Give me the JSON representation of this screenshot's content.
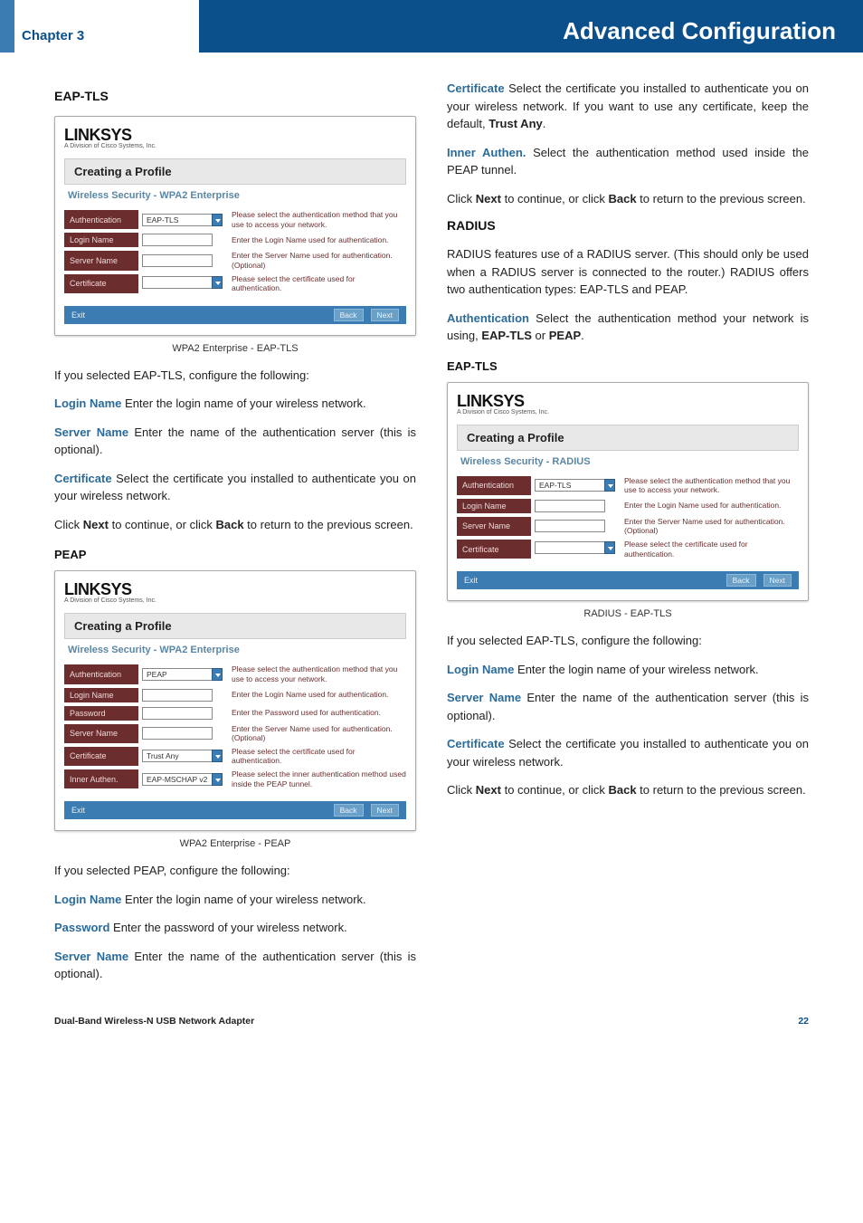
{
  "header": {
    "chapter": "Chapter 3",
    "title": "Advanced Configuration"
  },
  "footer": {
    "product": "Dual-Band Wireless-N USB Network Adapter",
    "page": "22"
  },
  "col1": {
    "h_eaptls": "EAP-TLS",
    "shot_wpa2tls": {
      "logo": "LINKSYS",
      "logo_sub": "A Division of Cisco Systems, Inc.",
      "title": "Creating a Profile",
      "sec": "Wireless Security - WPA2 Enterprise",
      "rows": [
        {
          "label": "Authentication",
          "value": "EAP-TLS",
          "select": true,
          "help": "Please select the authentication method that you use to access your network."
        },
        {
          "label": "Login Name",
          "value": "",
          "select": false,
          "help": "Enter the Login Name used for authentication."
        },
        {
          "label": "Server Name",
          "value": "",
          "select": false,
          "help": "Enter the Server Name used for authentication. (Optional)"
        },
        {
          "label": "Certificate",
          "value": "",
          "select": true,
          "help": "Please select the certificate used for authentication."
        }
      ],
      "footer": {
        "exit": "Exit",
        "back": "Back",
        "next": "Next"
      }
    },
    "cap_wpa2tls": "WPA2 Enterprise - EAP-TLS",
    "p_tls_intro": "If you selected EAP-TLS, configure the following:",
    "t_login": "Login Name",
    "p_login": " Enter the login name of your wireless network.",
    "t_server": "Server Name",
    "p_server": "  Enter the name of the authentication server (this is optional).",
    "t_cert": "Certificate",
    "p_cert": " Select the certificate you installed to authenticate you on your wireless network.",
    "p_nextback1_a": "Click ",
    "p_nextback1_b": " to continue, or click ",
    "p_nextback1_c": " to return to the previous screen.",
    "bold_next": "Next",
    "bold_back": "Back",
    "h_peap": "PEAP",
    "shot_wpa2peap": {
      "logo": "LINKSYS",
      "logo_sub": "A Division of Cisco Systems, Inc.",
      "title": "Creating a Profile",
      "sec": "Wireless Security - WPA2 Enterprise",
      "rows": [
        {
          "label": "Authentication",
          "value": "PEAP",
          "select": true,
          "help": "Please select the authentication method that you use to access your network."
        },
        {
          "label": "Login Name",
          "value": "",
          "select": false,
          "help": "Enter the Login Name used for authentication."
        },
        {
          "label": "Password",
          "value": "",
          "select": false,
          "help": "Enter the Password used for authentication."
        },
        {
          "label": "Server Name",
          "value": "",
          "select": false,
          "help": "Enter the Server Name used for authentication. (Optional)"
        },
        {
          "label": "Certificate",
          "value": "Trust Any",
          "select": true,
          "help": "Please select the certificate used for authentication."
        },
        {
          "label": "Inner Authen.",
          "value": "EAP-MSCHAP v2",
          "select": true,
          "help": "Please select the inner authentication method used inside the PEAP tunnel."
        }
      ],
      "footer": {
        "exit": "Exit",
        "back": "Back",
        "next": "Next"
      }
    },
    "cap_wpa2peap": "WPA2 Enterprise - PEAP",
    "p_peap_intro": "If you selected PEAP, configure the following:",
    "t_login2": "Login Name",
    "p_login2": " Enter the login name of your wireless network.",
    "t_password": "Password",
    "p_password": "  Enter the password of your wireless network.",
    "t_server2": "Server Name",
    "p_server2": "  Enter the name of the authentication server (this is optional)."
  },
  "col2": {
    "t_cert2": "Certificate",
    "p_cert2": " Select the certificate you installed to authenticate you on your wireless network. If you want to use any certificate, keep the default, ",
    "bold_trustany": "Trust Any",
    "p_cert2_end": ".",
    "t_inner": "Inner Authen.",
    "p_inner": " Select the authentication method used inside the PEAP tunnel.",
    "p_nextback2_a": "Click ",
    "p_nextback2_b": " to continue, or click ",
    "p_nextback2_c": " to return to the previous screen.",
    "bold_next": "Next",
    "bold_back": "Back",
    "h_radius": "RADIUS",
    "p_radius1": "RADIUS features use of a RADIUS server. (This should only be used when a RADIUS server is connected to the router.) RADIUS offers two authentication types: EAP-TLS and PEAP.",
    "t_auth": "Authentication",
    "p_auth_a": " Select the authentication method your network is using, ",
    "bold_eaptls": "EAP-TLS",
    "p_auth_or": " or ",
    "bold_peap": "PEAP",
    "p_auth_end": ".",
    "h_eaptls2": "EAP-TLS",
    "shot_radiustls": {
      "logo": "LINKSYS",
      "logo_sub": "A Division of Cisco Systems, Inc.",
      "title": "Creating a Profile",
      "sec": "Wireless Security - RADIUS",
      "rows": [
        {
          "label": "Authentication",
          "value": "EAP-TLS",
          "select": true,
          "help": "Please select the authentication method that you use to access your network."
        },
        {
          "label": "Login Name",
          "value": "",
          "select": false,
          "help": "Enter the Login Name used for authentication."
        },
        {
          "label": "Server Name",
          "value": "",
          "select": false,
          "help": "Enter the Server Name used for authentication. (Optional)"
        },
        {
          "label": "Certificate",
          "value": "",
          "select": true,
          "help": "Please select the certificate used for authentication."
        }
      ],
      "footer": {
        "exit": "Exit",
        "back": "Back",
        "next": "Next"
      }
    },
    "cap_radiustls": "RADIUS - EAP-TLS",
    "p_rtls_intro": "If you selected EAP-TLS, configure the following:",
    "t_login3": "Login Name",
    "p_login3": " Enter the login name of your wireless network.",
    "t_server3": "Server Name",
    "p_server3": "  Enter the name of the authentication server (this is optional).",
    "t_cert3": "Certificate",
    "p_cert3": " Select the certificate you installed to authenticate you on your wireless network.",
    "p_nextback3_a": "Click ",
    "p_nextback3_b": " to continue, or click ",
    "p_nextback3_c": " to return to the previous screen."
  }
}
